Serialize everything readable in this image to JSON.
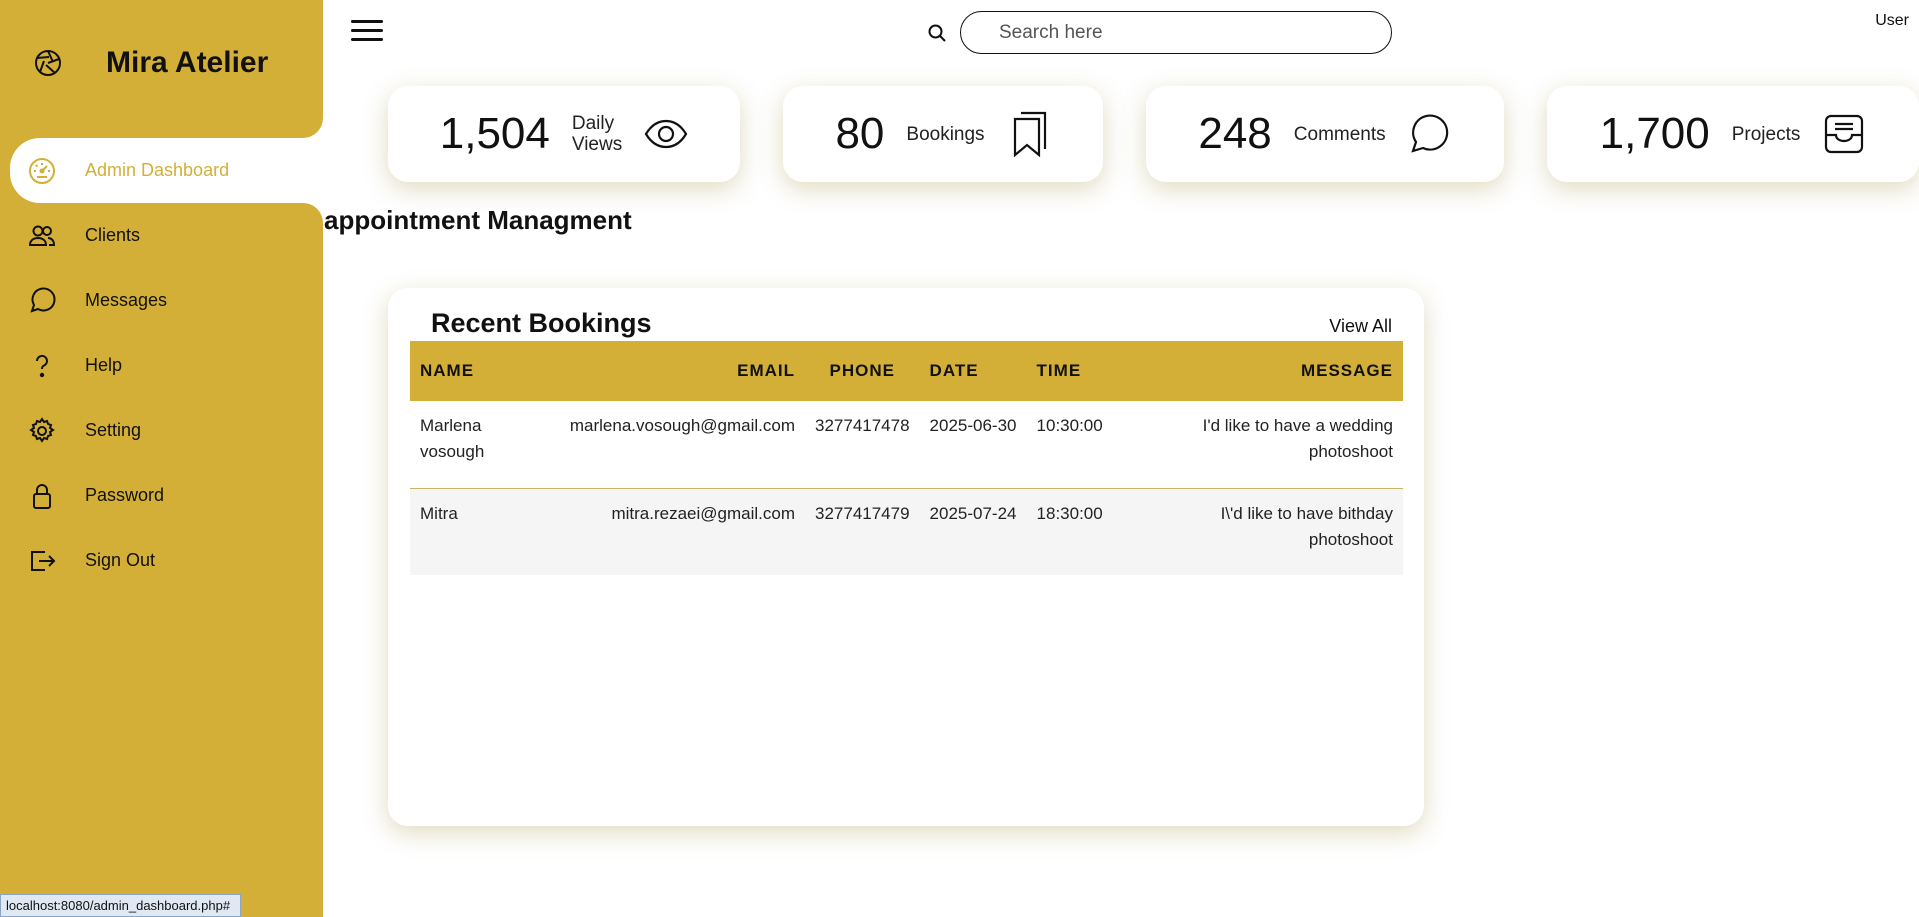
{
  "brand": {
    "name": "Mira Atelier",
    "logo_icon": "aperture-icon"
  },
  "sidebar": {
    "items": [
      {
        "label": "Admin Dashboard",
        "icon": "speedometer-icon",
        "active": true
      },
      {
        "label": "Clients",
        "icon": "people-icon"
      },
      {
        "label": "Messages",
        "icon": "chat-bubble-icon"
      },
      {
        "label": "Help",
        "icon": "question-icon"
      },
      {
        "label": "Setting",
        "icon": "gear-icon"
      },
      {
        "label": "Password",
        "icon": "lock-icon"
      },
      {
        "label": "Sign Out",
        "icon": "sign-out-icon"
      }
    ]
  },
  "topbar": {
    "search_placeholder": "Search here",
    "user_alt": "User"
  },
  "cards": [
    {
      "number": "1,504",
      "name_line1": "Daily",
      "name_line2": "Views",
      "icon": "eye-icon"
    },
    {
      "number": "80",
      "name_line1": "Bookings",
      "name_line2": "",
      "icon": "bookmarks-icon"
    },
    {
      "number": "248",
      "name_line1": "Comments",
      "name_line2": "",
      "icon": "chat-icon"
    },
    {
      "number": "1,700",
      "name_line1": "Projects",
      "name_line2": "",
      "icon": "inbox-icon"
    }
  ],
  "section_title": "appointment Managment",
  "bookings": {
    "title": "Recent Bookings",
    "view_all": "View All",
    "columns": [
      "NAME",
      "EMAIL",
      "PHONE",
      "DATE",
      "TIME",
      "MESSAGE"
    ],
    "rows": [
      {
        "name": "Marlena vosough",
        "email": "marlena.vosough@gmail.com",
        "phone": "3277417478",
        "date": "2025-06-30",
        "time": "10:30:00",
        "message": "I'd like to have a wedding photoshoot"
      },
      {
        "name": "Mitra",
        "email": "mitra.rezaei@gmail.com",
        "phone": "3277417479",
        "date": "2025-07-24",
        "time": "18:30:00",
        "message": "I\\'d like to have bithday photoshoot"
      }
    ]
  },
  "statusbar": {
    "url": "localhost:8080/admin_dashboard.php#"
  },
  "colors": {
    "accent": "#d4af37"
  }
}
